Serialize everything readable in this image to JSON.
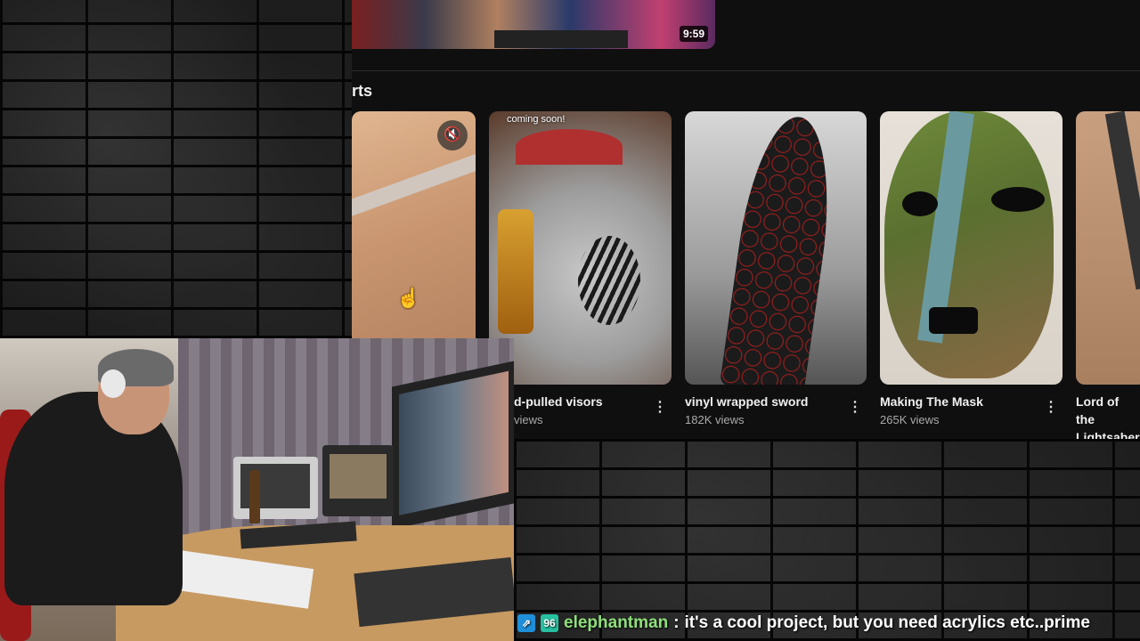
{
  "top_video": {
    "duration": "9:59"
  },
  "shorts": {
    "heading": "rts",
    "items": [
      {
        "title": "",
        "views": ""
      },
      {
        "title": "d-pulled visors",
        "views": "views",
        "overlay_text": "coming soon!"
      },
      {
        "title": "vinyl wrapped sword",
        "views": "182K views"
      },
      {
        "title": "Making The Mask",
        "views": "265K views"
      },
      {
        "title": "Lord of the Lightsaber",
        "title_line1": "Lord of the",
        "title_line2": "Lightsaber",
        "views": ""
      }
    ],
    "mute_icon": "🔇",
    "menu_icon": "⋮"
  },
  "chat": {
    "username": "elephantman",
    "separator": ":",
    "message": "it's a cool project, but you need acrylics etc..prime",
    "badge_1": "⇗",
    "badge_2": "96"
  },
  "colors": {
    "chat_username": "#8fe07a",
    "badge_blue": "#1e8fd8",
    "badge_teal": "#26c0a0"
  }
}
